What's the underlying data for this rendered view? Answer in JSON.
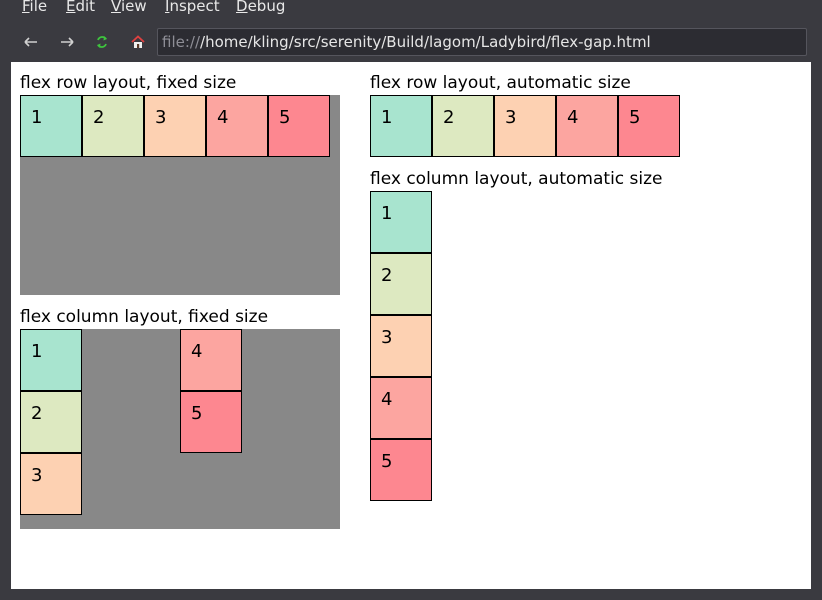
{
  "menubar": {
    "items": [
      "File",
      "Edit",
      "View",
      "Inspect",
      "Debug"
    ],
    "mnemonics": [
      "F",
      "E",
      "V",
      "I",
      "D"
    ]
  },
  "toolbar": {
    "back_icon": "arrow-left",
    "forward_icon": "arrow-right",
    "reload_icon": "reload",
    "home_icon": "home",
    "url_scheme": "file://",
    "url_path": "/home/kling/src/serenity/Build/lagom/Ladybird/flex-gap.html"
  },
  "page": {
    "sections": {
      "row_fixed": {
        "title": "flex row layout, fixed size",
        "items": [
          "1",
          "2",
          "3",
          "4",
          "5"
        ]
      },
      "row_auto": {
        "title": "flex row layout, automatic size",
        "items": [
          "1",
          "2",
          "3",
          "4",
          "5"
        ]
      },
      "col_fixed": {
        "title": "flex column layout, fixed size",
        "items": [
          "1",
          "2",
          "3",
          "4",
          "5"
        ]
      },
      "col_auto": {
        "title": "flex column layout, automatic size",
        "items": [
          "1",
          "2",
          "3",
          "4",
          "5"
        ]
      }
    },
    "colors": {
      "container": "#888888",
      "item1": "#a8e4cf",
      "item2": "#dde9c1",
      "item3": "#fdd1b2",
      "item4": "#fca5a0",
      "item5": "#fd8790"
    }
  }
}
